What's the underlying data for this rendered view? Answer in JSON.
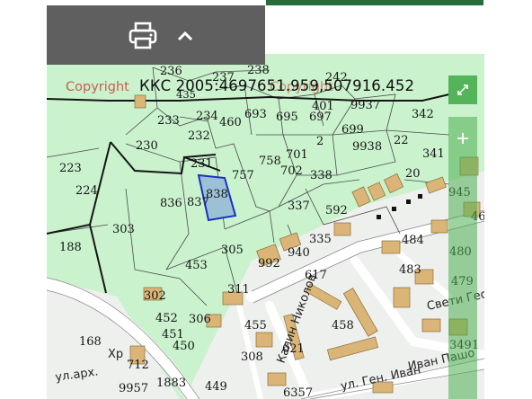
{
  "map": {
    "copyright": "Copyright",
    "copyright_tail": "Copyright",
    "coordinates": "ККС 2005:4697651.959,507916.452",
    "parcels": [
      {
        "num": "236"
      },
      {
        "num": "237"
      },
      {
        "num": "238"
      },
      {
        "num": "242"
      },
      {
        "num": "435"
      },
      {
        "num": "233"
      },
      {
        "num": "234"
      },
      {
        "num": "460"
      },
      {
        "num": "693"
      },
      {
        "num": "695"
      },
      {
        "num": "697"
      },
      {
        "num": "401"
      },
      {
        "num": "9937"
      },
      {
        "num": "342"
      },
      {
        "num": "232"
      },
      {
        "num": "230"
      },
      {
        "num": "701"
      },
      {
        "num": "2"
      },
      {
        "num": "699"
      },
      {
        "num": "9938"
      },
      {
        "num": "22"
      },
      {
        "num": "341"
      },
      {
        "num": "223"
      },
      {
        "num": "231"
      },
      {
        "num": "757"
      },
      {
        "num": "758"
      },
      {
        "num": "702"
      },
      {
        "num": "338"
      },
      {
        "num": "20"
      },
      {
        "num": "224"
      },
      {
        "num": "836"
      },
      {
        "num": "838"
      },
      {
        "num": "837"
      },
      {
        "num": "337"
      },
      {
        "num": "592"
      },
      {
        "num": "945"
      },
      {
        "num": "46"
      },
      {
        "num": "303"
      },
      {
        "num": "188"
      },
      {
        "num": "305"
      },
      {
        "num": "335"
      },
      {
        "num": "484"
      },
      {
        "num": "480"
      },
      {
        "num": "940"
      },
      {
        "num": "992"
      },
      {
        "num": "453"
      },
      {
        "num": "617"
      },
      {
        "num": "483"
      },
      {
        "num": "479"
      },
      {
        "num": "311"
      },
      {
        "num": "302"
      },
      {
        "num": "458"
      },
      {
        "num": "452"
      },
      {
        "num": "306"
      },
      {
        "num": "455"
      },
      {
        "num": "451"
      },
      {
        "num": "168"
      },
      {
        "num": "450"
      },
      {
        "num": "621"
      },
      {
        "num": "308"
      },
      {
        "num": "1883"
      },
      {
        "num": "449"
      },
      {
        "num": "6357"
      },
      {
        "num": "9957"
      },
      {
        "num": "712"
      },
      {
        "num": "3491"
      }
    ],
    "streets": {
      "gen": "ул. Ген. Иван",
      "arh": "ул.арх.",
      "kalin": "Калин Николов",
      "georgi": "Свети Георги",
      "ivan_pashov": "Иван Пашо",
      "hr": "Хр"
    },
    "highlight_parcel": "838",
    "colors": {
      "land": "#c7f2cb",
      "road": "#ffffff",
      "building": "#dbb577",
      "highlight_fill": "#9cc1d5",
      "highlight_stroke": "#1c2fc4",
      "toolbar_bg": "#5f5f5f",
      "accent_green": "#256c3a"
    }
  },
  "toolbar": {
    "print_icon": "printer-icon",
    "collapse_icon": "chevron-up-icon"
  },
  "controls": {
    "fullscreen_icon": "expand-icon",
    "zoom_in_icon": "plus-icon"
  }
}
